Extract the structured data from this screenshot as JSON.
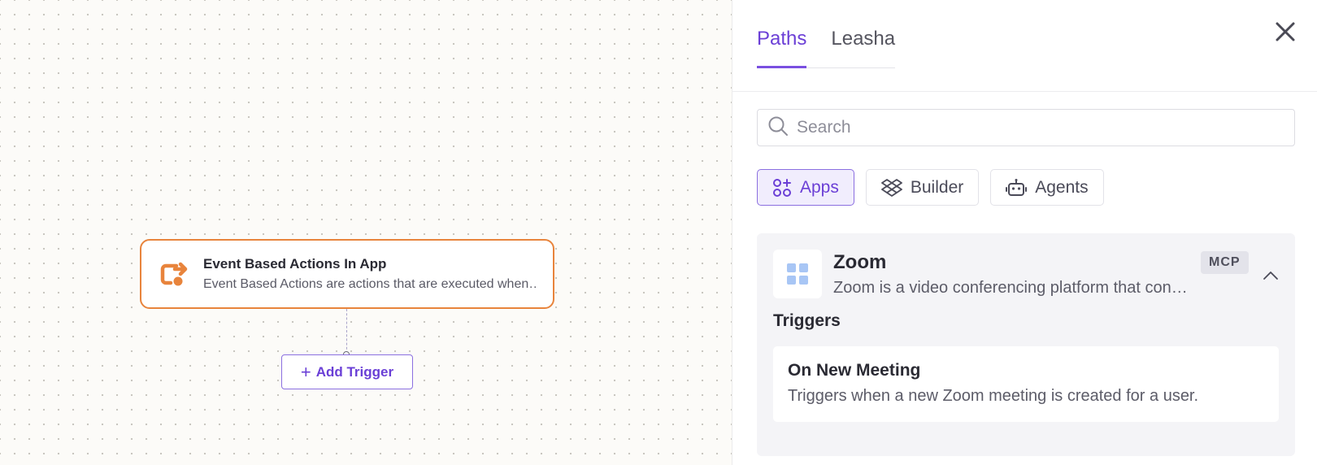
{
  "canvas": {
    "node": {
      "title": "Event Based Actions In App",
      "description": "Event Based Actions are actions that are executed when an event occurs in the app.",
      "icon": "event-action-icon",
      "accent_color": "#e8843c"
    },
    "add_trigger_label": "Add Trigger",
    "add_trigger_plus": "+"
  },
  "panel": {
    "tabs": [
      {
        "label": "Paths",
        "active": true
      },
      {
        "label": "Leasha",
        "active": false
      }
    ],
    "close_icon": "close-icon",
    "search": {
      "placeholder": "Search",
      "value": ""
    },
    "filters": [
      {
        "label": "Apps",
        "icon": "apps-icon",
        "active": true
      },
      {
        "label": "Builder",
        "icon": "builder-icon",
        "active": false
      },
      {
        "label": "Agents",
        "icon": "robot-icon",
        "active": false
      }
    ],
    "app": {
      "name": "Zoom",
      "description": "Zoom is a video conferencing platform that connects teams and people.",
      "badge": "MCP",
      "icon": "app-grid-icon",
      "section_title": "Triggers",
      "triggers": [
        {
          "name": "On New Meeting",
          "description": "Triggers when a new Zoom meeting is created for a user."
        }
      ]
    },
    "accent_color": "#6b3fd6"
  }
}
